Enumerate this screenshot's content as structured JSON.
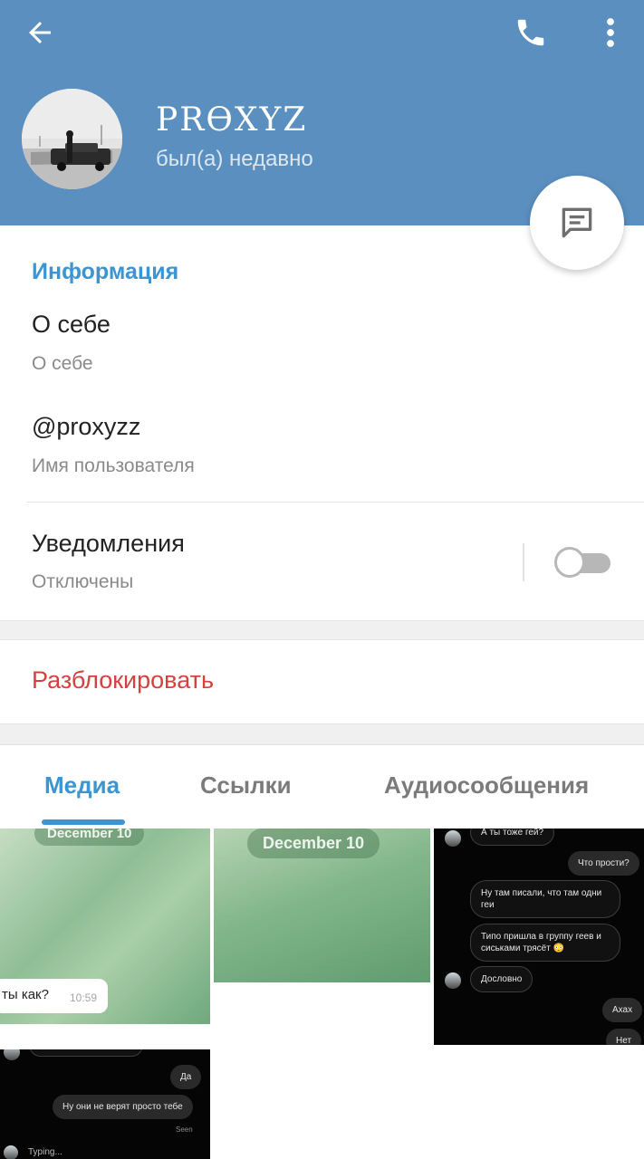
{
  "header": {
    "name": "PRӨXYZ",
    "status": "был(а) недавно",
    "icons": {
      "back": "arrow-left-icon",
      "call": "phone-icon",
      "more": "more-vertical-icon",
      "fab": "message-icon"
    },
    "background_color": "#5b8fbf"
  },
  "info": {
    "section_title": "Информация",
    "bio_value": "О себе",
    "bio_label": "О себе",
    "username_value": "@proxyzz",
    "username_label": "Имя пользователя",
    "notifications_label": "Уведомления",
    "notifications_value": "Отключены",
    "notifications_enabled": false
  },
  "actions": {
    "unblock_label": "Разблокировать",
    "unblock_color": "#d8403f"
  },
  "tabs": [
    {
      "label": "Медиа",
      "active": true
    },
    {
      "label": "Ссылки",
      "active": false
    },
    {
      "label": "Аудиосообщения",
      "active": false
    }
  ],
  "accent_color": "#3a95d2",
  "media": {
    "tile1": {
      "date": "December 10",
      "message": "ты как?",
      "time": "10:59"
    },
    "tile2": {
      "date": "December 10"
    },
    "tile3": {
      "messages": [
        "А ты тоже гей?",
        "Что прости?",
        "Ну там писали, что там одни геи",
        "Типо пришла в группу геев и сиськами трясёт 😳",
        "Дословно",
        "Ахах",
        "Нет"
      ]
    },
    "tile4": {
      "messages": [
        "Да",
        "Ну они не верят просто тебе"
      ],
      "seen": "Seen",
      "typing": "Typing..."
    }
  }
}
